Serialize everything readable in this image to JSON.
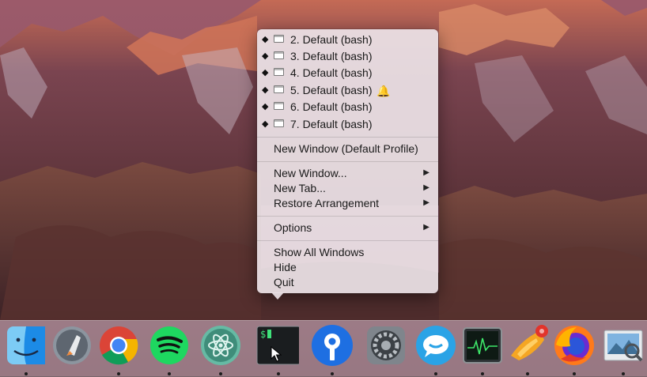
{
  "menu": {
    "window_items": [
      {
        "label": "2. Default (bash)",
        "bell": false
      },
      {
        "label": "3. Default (bash)",
        "bell": false
      },
      {
        "label": "4. Default (bash)",
        "bell": false
      },
      {
        "label": "5. Default (bash)",
        "bell": true
      },
      {
        "label": "6. Default (bash)",
        "bell": false
      },
      {
        "label": "7. Default (bash)",
        "bell": false
      }
    ],
    "new_window_default": "New Window (Default Profile)",
    "new_window": "New Window...",
    "new_tab": "New Tab...",
    "restore_arrangement": "Restore Arrangement",
    "options": "Options",
    "show_all_windows": "Show All Windows",
    "hide": "Hide",
    "quit": "Quit",
    "window_marker": "◆",
    "submenu_arrow": "▶",
    "bell_icon": "🔔"
  },
  "dock": {
    "apps": [
      {
        "name": "finder",
        "running": true
      },
      {
        "name": "launchpad",
        "running": false
      },
      {
        "name": "chrome",
        "running": true
      },
      {
        "name": "spotify",
        "running": true
      },
      {
        "name": "atom",
        "running": true
      },
      {
        "name": "iterm2",
        "running": true
      },
      {
        "name": "sourcetree",
        "running": true
      },
      {
        "name": "system-preferences",
        "running": false
      },
      {
        "name": "messages",
        "running": true
      },
      {
        "name": "activity-monitor",
        "running": true
      },
      {
        "name": "rocket-typist",
        "running": true
      },
      {
        "name": "firefox",
        "running": true
      },
      {
        "name": "preview",
        "running": true
      }
    ],
    "terminal_prompt": "$"
  },
  "colors": {
    "menu_bg": "#ece2e6",
    "chrome_red": "#db4437",
    "chrome_green": "#0f9d58",
    "chrome_yellow": "#f4b400",
    "chrome_blue": "#4285f4",
    "spotify_green": "#1ed760",
    "atom_teal": "#66baa4",
    "sourcetree_blue": "#1e6fe2",
    "firefox_orange": "#ff7a1a"
  }
}
